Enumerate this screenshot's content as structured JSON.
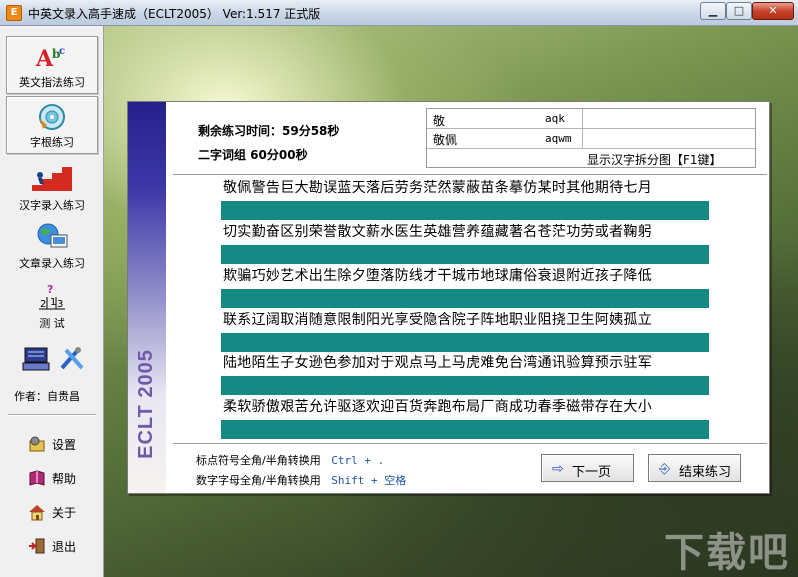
{
  "window": {
    "title": "中英文录入高手速成（ECLT2005） Ver:1.517 正式版",
    "icon": "app-icon"
  },
  "sidebar": {
    "items": [
      {
        "label": "英文指法练习",
        "icon": "abc-icon"
      },
      {
        "label": "字根练习",
        "icon": "cd-icon"
      },
      {
        "label": "汉字录入练习",
        "icon": "stairs-icon"
      },
      {
        "label": "文章录入练习",
        "icon": "globe-icon"
      },
      {
        "label": "测  试",
        "icon": "test-icon"
      }
    ],
    "author": "作者：自贵昌",
    "small_items": [
      {
        "label": "设置",
        "icon": "settings-icon"
      },
      {
        "label": "帮助",
        "icon": "help-book-icon"
      },
      {
        "label": "关于",
        "icon": "home-icon"
      },
      {
        "label": "退出",
        "icon": "exit-icon"
      }
    ]
  },
  "panel": {
    "brand": "ECLT 2005",
    "remaining_time": "剩余练习时间：59分58秒",
    "group": "二字词组    60分00秒",
    "hint": {
      "row1_char": "敬",
      "row1_code": "aqk",
      "row2_char": "敬佩",
      "row2_code": "aqwm",
      "row3_text": "显示汉字拆分图【F1键】"
    },
    "lines": [
      "敬佩警告巨大勘误蓝天落后劳务茫然蒙蔽苗条摹仿某时其他期待七月",
      "切实勤奋区别荣誉散文薪水医生英雄营养蕴藏著名苍茫功劳或者鞠躬",
      "欺骗巧妙艺术出生除夕堕落防线才干城市地球庸俗衰退附近孩子降低",
      "联系辽阔取消随意限制阳光享受隐含院子阵地职业阻挠卫生阿姨孤立",
      "陆地陌生子女逊色参加对于观点马上马虎难免台湾通讯验算预示驻军",
      "柔软骄傲艰苦允许驱逐欢迎百货奔跑布局厂商成功春季磁带存在大小"
    ],
    "shortcuts": [
      {
        "text": "标点符号全角/半角转换用",
        "key": "Ctrl  + ."
      },
      {
        "text": "数字字母全角/半角转换用",
        "key": "Shift + 空格"
      }
    ],
    "next_label": "下一页",
    "end_label": "结束练习"
  },
  "watermark": "下载吧"
}
